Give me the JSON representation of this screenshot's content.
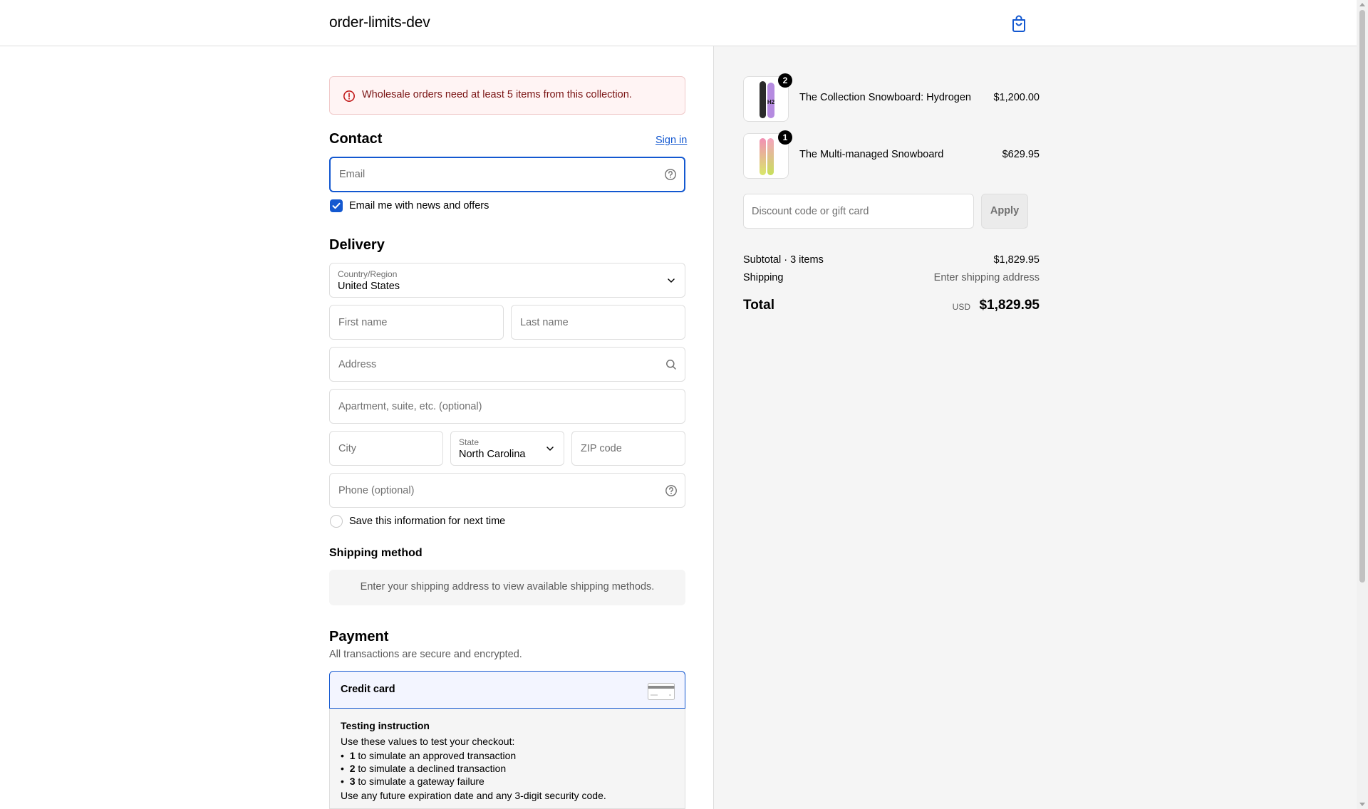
{
  "header": {
    "shop_name": "order-limits-dev",
    "cart_icon": "shopping-bag-icon"
  },
  "banner": {
    "message": "Wholesale orders need at least 5 items from this collection.",
    "icon": "alert-circle-icon",
    "color": "#7a1414"
  },
  "contact": {
    "title": "Contact",
    "sign_in": "Sign in",
    "email_placeholder": "Email",
    "newsletter_label": "Email me with news and offers",
    "newsletter_checked": true
  },
  "delivery": {
    "title": "Delivery",
    "country_label": "Country/Region",
    "country_value": "United States",
    "first_name_placeholder": "First name",
    "last_name_placeholder": "Last name",
    "address_placeholder": "Address",
    "apartment_placeholder": "Apartment, suite, etc. (optional)",
    "city_placeholder": "City",
    "state_label": "State",
    "state_value": "North Carolina",
    "zip_placeholder": "ZIP code",
    "phone_placeholder": "Phone (optional)",
    "save_info_label": "Save this information for next time",
    "save_info_checked": false
  },
  "shipping_method": {
    "title": "Shipping method",
    "message": "Enter your shipping address to view available shipping methods."
  },
  "payment": {
    "title": "Payment",
    "subtitle": "All transactions are secure and encrypted.",
    "method_label": "Credit card",
    "testing_title": "Testing instruction",
    "testing_intro": "Use these values to test your checkout:",
    "testing_items": [
      {
        "code": "1",
        "text": " to simulate an approved transaction"
      },
      {
        "code": "2",
        "text": " to simulate a declined transaction"
      },
      {
        "code": "3",
        "text": " to simulate a gateway failure"
      }
    ],
    "testing_footer": "Use any future expiration date and any 3-digit security code."
  },
  "summary": {
    "items": [
      {
        "name": "The Collection Snowboard: Hydrogen",
        "price": "$1,200.00",
        "quantity": "2"
      },
      {
        "name": "The Multi-managed Snowboard",
        "price": "$629.95",
        "quantity": "1"
      }
    ],
    "discount_placeholder": "Discount code or gift card",
    "apply_label": "Apply",
    "subtotal_label": "Subtotal · 3 items",
    "subtotal_value": "$1,829.95",
    "shipping_label": "Shipping",
    "shipping_value": "Enter shipping address",
    "total_label": "Total",
    "total_currency": "USD",
    "total_value": "$1,829.95"
  },
  "colors": {
    "accent": "#1358d0",
    "summary_bg": "#f5f5f5",
    "error_bg": "#fff4f4"
  }
}
